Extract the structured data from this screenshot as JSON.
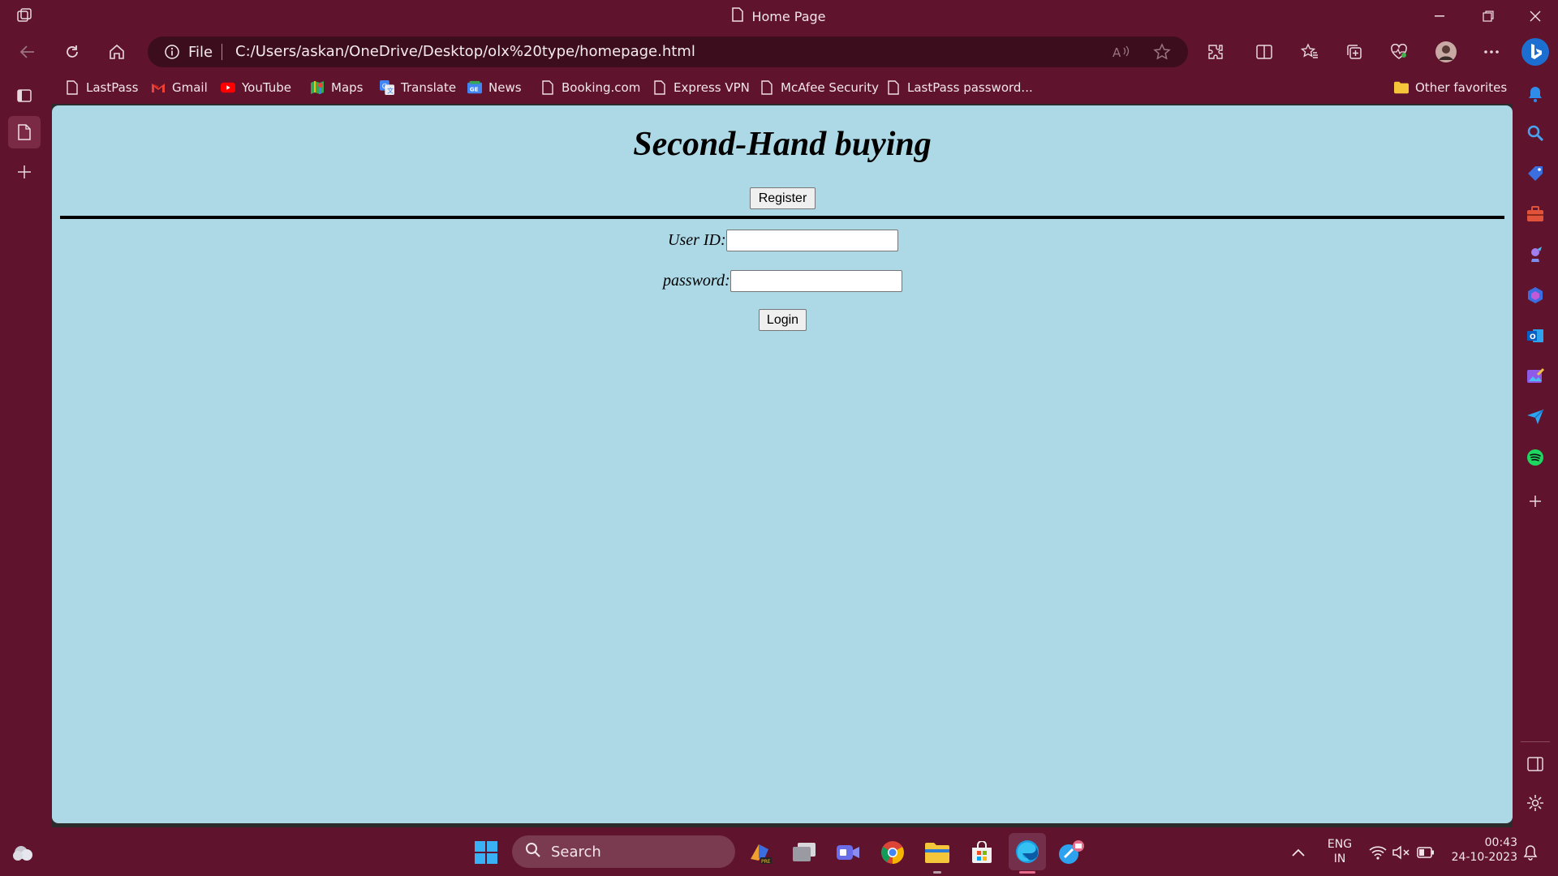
{
  "window": {
    "title": "Home Page"
  },
  "toolbar": {
    "address_prefix": "File",
    "url": "C:/Users/askan/OneDrive/Desktop/olx%20type/homepage.html"
  },
  "bookmarks": {
    "items": [
      {
        "label": "LastPass",
        "icon": "page-icon"
      },
      {
        "label": "Gmail",
        "icon": "gmail-icon"
      },
      {
        "label": "YouTube",
        "icon": "youtube-icon"
      },
      {
        "label": "Maps",
        "icon": "maps-icon"
      },
      {
        "label": "Translate",
        "icon": "translate-icon"
      },
      {
        "label": "News",
        "icon": "news-icon"
      },
      {
        "label": "Booking.com",
        "icon": "page-icon"
      },
      {
        "label": "Express VPN",
        "icon": "page-icon"
      },
      {
        "label": "McAfee Security",
        "icon": "page-icon"
      },
      {
        "label": "LastPass password...",
        "icon": "page-icon"
      }
    ],
    "other_favorites": "Other favorites"
  },
  "page": {
    "heading": "Second-Hand buying",
    "register_label": "Register",
    "user_id_label": "User ID:",
    "user_id_value": "",
    "password_label": "password:",
    "password_value": "",
    "login_label": "Login",
    "background_color": "#add8e6"
  },
  "taskbar": {
    "search_label": "Search",
    "language_line1": "ENG",
    "language_line2": "IN",
    "time": "00:43",
    "date": "24-10-2023"
  },
  "colors": {
    "chrome": "#5f132d",
    "address_bar": "#3b0d1d",
    "page_background": "#add8e6"
  }
}
